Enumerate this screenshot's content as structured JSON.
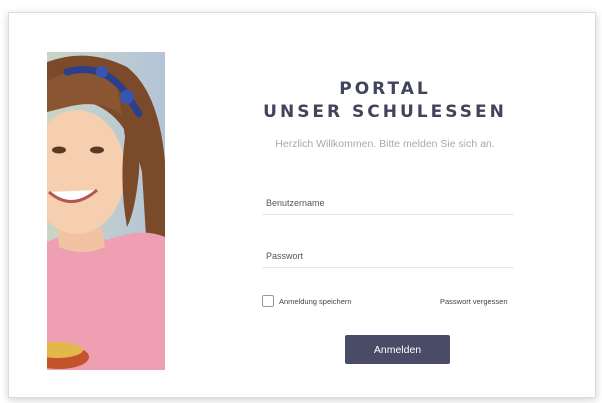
{
  "header": {
    "title_line1": "PORTAL",
    "title_line2": "UNSER SCHULESSEN",
    "welcome": "Herzlich Willkommen. Bitte melden Sie sich an."
  },
  "form": {
    "username_placeholder": "Benutzername",
    "password_placeholder": "Passwort",
    "remember_label": "Anmeldung speichern",
    "remember_checked": false,
    "forgot_link": "Passwort vergessen",
    "submit_label": "Anmelden"
  },
  "colors": {
    "title": "#42445c",
    "button_bg": "#4a4b66",
    "subtitle": "#a9a9a9"
  }
}
